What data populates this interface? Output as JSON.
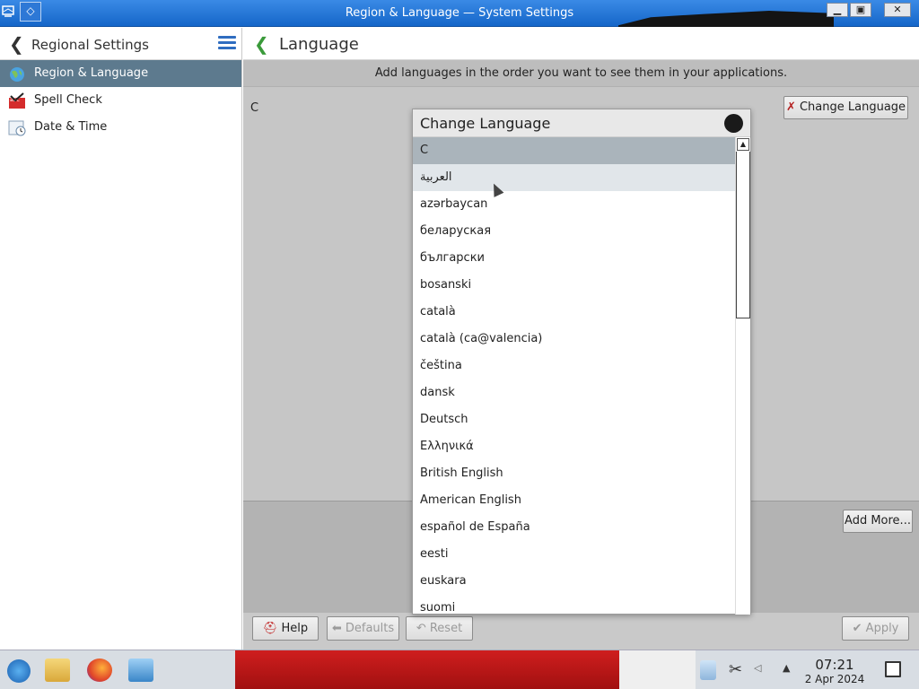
{
  "window": {
    "title": "Region & Language — System Settings",
    "minimize_glyph": "▁",
    "maximize_glyph": "▣",
    "close_glyph": "✕"
  },
  "sidebar": {
    "title": "Regional Settings",
    "items": [
      {
        "label": "Region & Language",
        "icon": "globe-icon",
        "active": true
      },
      {
        "label": "Spell Check",
        "icon": "spell-check-icon",
        "active": false
      },
      {
        "label": "Date & Time",
        "icon": "calendar-icon",
        "active": false
      }
    ]
  },
  "main": {
    "title": "Language",
    "hint": "Add languages in the order you want to see them in your applications.",
    "current_language": "C",
    "change_language_label": "Change Language",
    "add_more_label": "Add More...",
    "help_label": "Help",
    "defaults_label": "Defaults",
    "reset_label": "Reset",
    "apply_label": "Apply"
  },
  "dialog": {
    "title": "Change Language",
    "languages": [
      "C",
      "العربية",
      "azərbaycan",
      "беларуская",
      "български",
      "bosanski",
      "català",
      "català (ca@valencia)",
      "čeština",
      "dansk",
      "Deutsch",
      "Ελληνικά",
      "British English",
      "American English",
      "español de España",
      "eesti",
      "euskara",
      "suomi"
    ],
    "selected_index": 0,
    "hovered_index": 1
  },
  "taskbar": {
    "time": "07:21",
    "date": "2 Apr 2024"
  },
  "colors": {
    "titlebar": "#1e6fd0",
    "selection": "#aab4bb",
    "sidebar_active": "#5d7a8e"
  }
}
